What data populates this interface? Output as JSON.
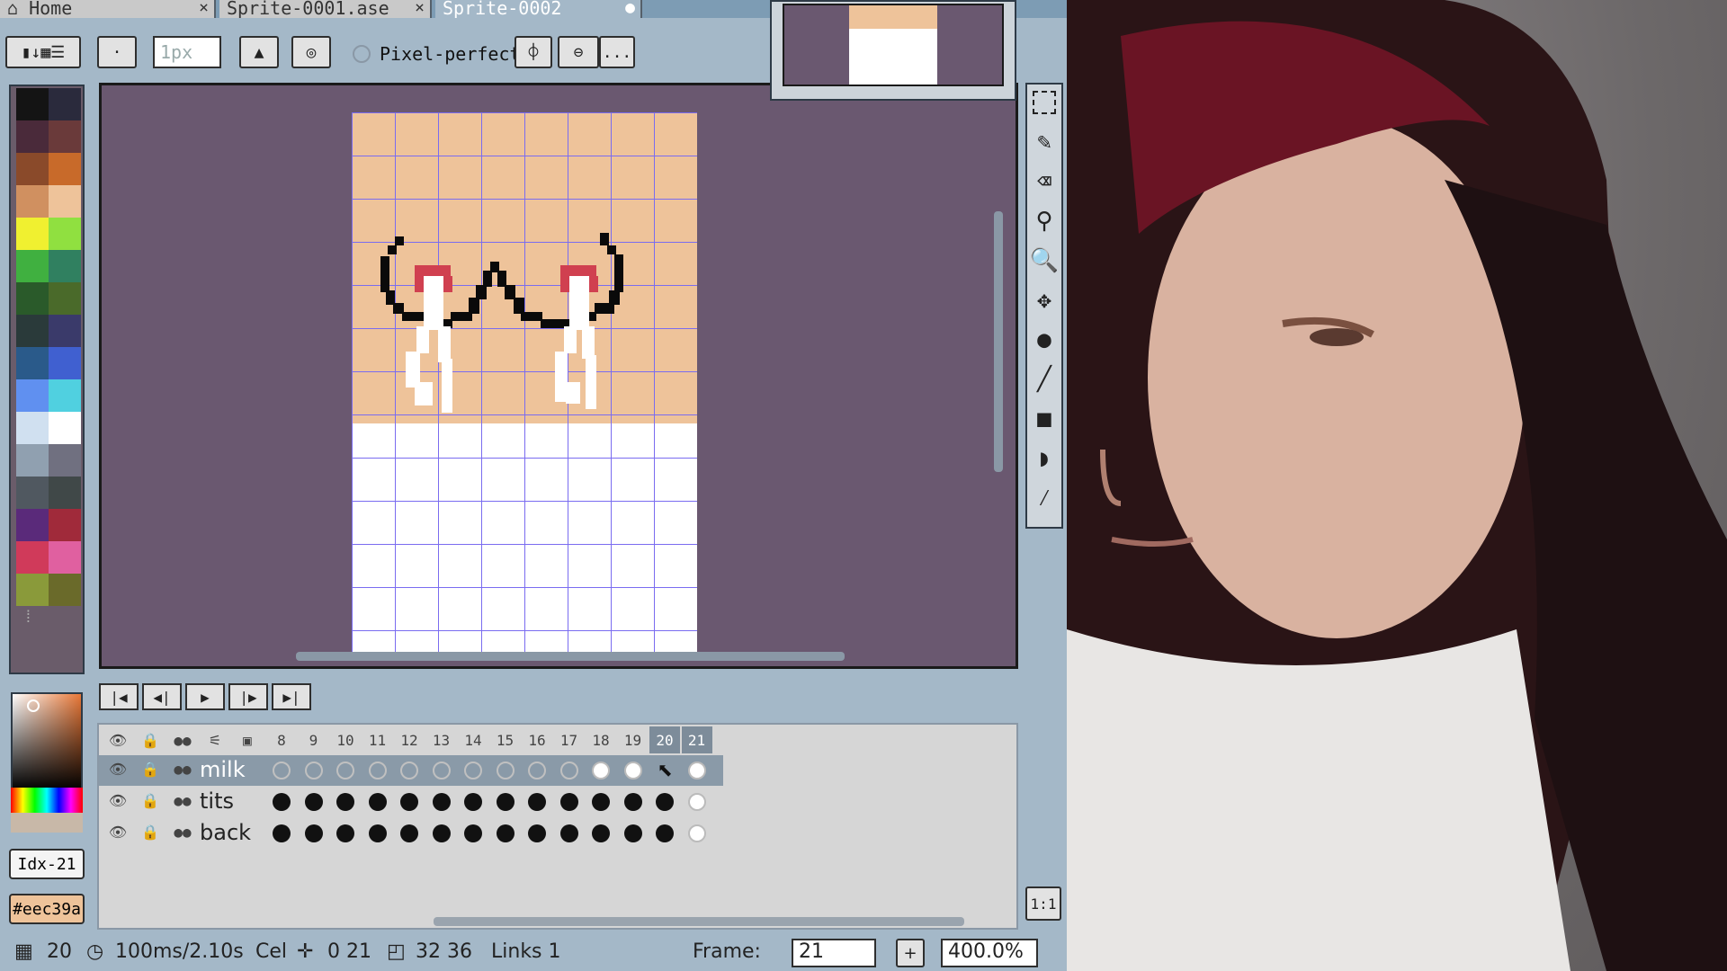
{
  "tabs": [
    {
      "label": "Home",
      "icon": "home-icon",
      "close": "×"
    },
    {
      "label": "Sprite-0001.ase",
      "close": "×"
    },
    {
      "label": "Sprite-0002",
      "close": "●"
    }
  ],
  "toolbar": {
    "brush_size": "1px",
    "pixel_perfect_label": "Pixel-perfect",
    "more_label": "..."
  },
  "palette": {
    "colors": [
      "#141414",
      "#2a2a3c",
      "#4a2a3a",
      "#6a3a3a",
      "#8a4a2a",
      "#c86a2a",
      "#d09060",
      "#eec39a",
      "#f0f030",
      "#90e040",
      "#40b040",
      "#308060",
      "#2a5a2a",
      "#4a6a2a",
      "#2a3a3a",
      "#3a3a6a",
      "#2a5a8a",
      "#4060d0",
      "#6090f0",
      "#50d0e0",
      "#d0e0f0",
      "#ffffff",
      "#90a0b0",
      "#707080",
      "#505860",
      "#404848",
      "#5a2a7a",
      "#a02a3a",
      "#d03a5a",
      "#e060a0",
      "#8a9a3a",
      "#6a6a2a"
    ]
  },
  "color_info": {
    "index": "Idx-21",
    "hex": "#eec39a"
  },
  "playback": [
    "first-frame-icon",
    "prev-frame-icon",
    "play-icon",
    "next-frame-icon",
    "last-frame-icon"
  ],
  "timeline": {
    "frames": [
      "8",
      "9",
      "10",
      "11",
      "12",
      "13",
      "14",
      "15",
      "16",
      "17",
      "18",
      "19",
      "20",
      "21"
    ],
    "layers": [
      {
        "name": "milk",
        "cels": [
          "e",
          "e",
          "e",
          "e",
          "e",
          "e",
          "e",
          "e",
          "e",
          "e",
          "h",
          "h",
          "c",
          "h"
        ]
      },
      {
        "name": "tits",
        "cels": [
          "f",
          "f",
          "f",
          "f",
          "f",
          "f",
          "f",
          "f",
          "f",
          "f",
          "f",
          "f",
          "f",
          "h"
        ]
      },
      {
        "name": "back",
        "cels": [
          "f",
          "f",
          "f",
          "f",
          "f",
          "f",
          "f",
          "f",
          "f",
          "f",
          "f",
          "f",
          "f",
          "h"
        ]
      }
    ]
  },
  "status": {
    "frames_count": "20",
    "duration": "100ms/2.10s",
    "cel_label": "Cel",
    "cel_pos": "0 21",
    "cel_size": "32 36",
    "links": "Links 1",
    "frame_label": "Frame:",
    "frame_value": "21",
    "zoom": "400.0%",
    "ratio": "1:1"
  },
  "colors": {
    "canvas_bg": "#6a5870",
    "skin": "#eec39a",
    "grid": "#7a6cf0",
    "ui_bg": "#a4b8c8"
  }
}
